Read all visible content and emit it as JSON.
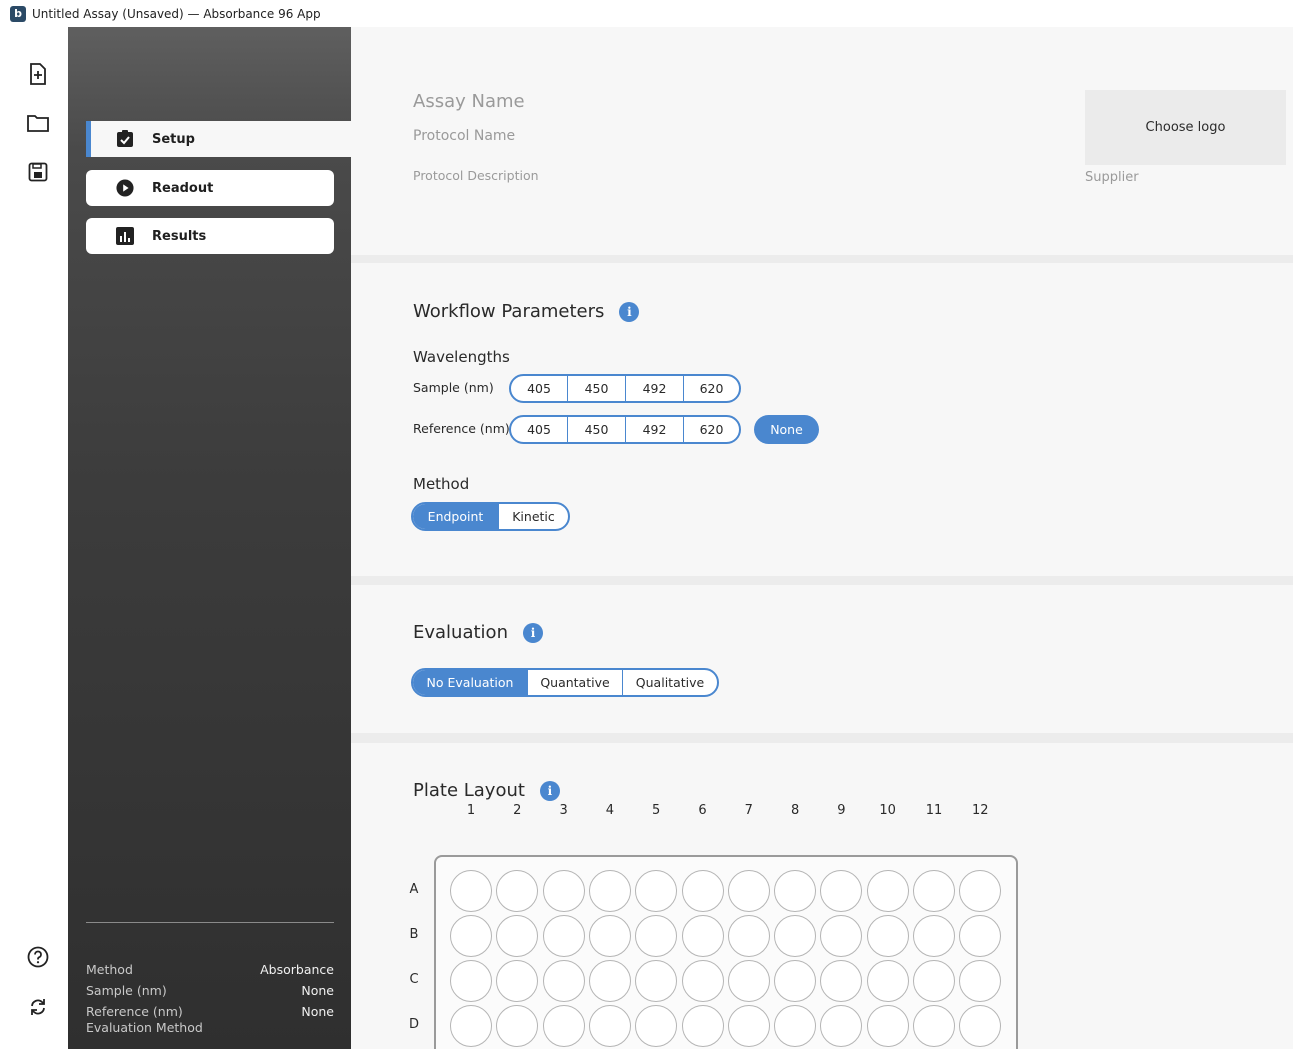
{
  "window": {
    "title": "Untitled Assay (Unsaved) — Absorbance 96 App",
    "logo_letter": "b"
  },
  "rail": {
    "top": [
      "new-file-icon",
      "folder-icon",
      "save-icon"
    ],
    "bottom": [
      "help-icon",
      "sync-icon"
    ]
  },
  "nav": [
    {
      "label": "Setup",
      "icon": "clipboard-check-icon",
      "active": true
    },
    {
      "label": "Readout",
      "icon": "play-circle-icon",
      "active": false
    },
    {
      "label": "Results",
      "icon": "bar-chart-icon",
      "active": false
    }
  ],
  "summary": [
    {
      "label": "Method",
      "value": "Absorbance"
    },
    {
      "label": "Sample (nm)",
      "value": "None"
    },
    {
      "label": "Reference (nm)",
      "value": "None"
    },
    {
      "label": "Evaluation Method",
      "value": ""
    }
  ],
  "header": {
    "assay_name_placeholder": "Assay Name",
    "protocol_name_placeholder": "Protocol Name",
    "protocol_description_placeholder": "Protocol Description",
    "choose_logo": "Choose logo",
    "supplier_placeholder": "Supplier"
  },
  "workflow": {
    "title": "Workflow Parameters",
    "wavelengths_title": "Wavelengths",
    "sample_label": "Sample (nm)",
    "reference_label": "Reference (nm)",
    "wavelength_options": [
      "405",
      "450",
      "492",
      "620"
    ],
    "none_label": "None",
    "method_title": "Method",
    "method_options": [
      {
        "label": "Endpoint",
        "selected": true
      },
      {
        "label": "Kinetic",
        "selected": false
      }
    ]
  },
  "evaluation": {
    "title": "Evaluation",
    "options": [
      {
        "label": "No Evaluation",
        "selected": true
      },
      {
        "label": "Quantative",
        "selected": false
      },
      {
        "label": "Qualitative",
        "selected": false
      }
    ]
  },
  "plate": {
    "title": "Plate Layout",
    "columns": [
      "1",
      "2",
      "3",
      "4",
      "5",
      "6",
      "7",
      "8",
      "9",
      "10",
      "11",
      "12"
    ],
    "rows": [
      "A",
      "B",
      "C",
      "D"
    ]
  },
  "colors": {
    "accent": "#4a87cf",
    "sidebar_dark": "#2f2f2f",
    "card": "#f7f7f7"
  }
}
